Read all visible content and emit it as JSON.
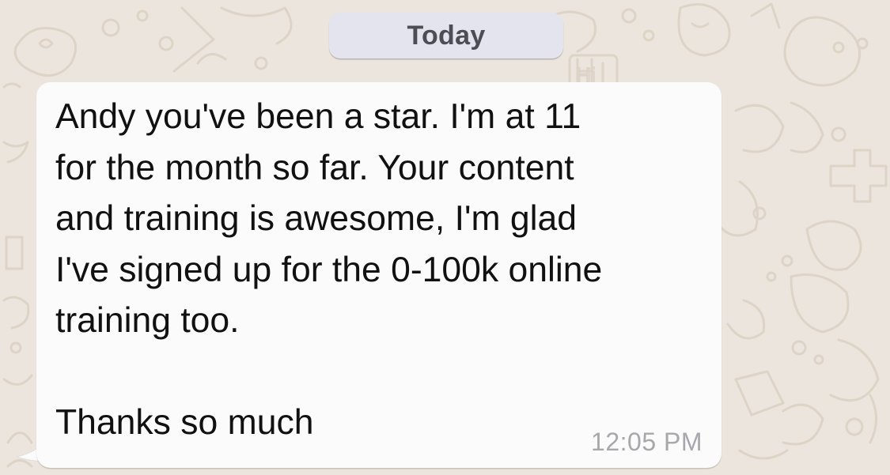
{
  "chat": {
    "date_separator": "Today",
    "messages": [
      {
        "direction": "incoming",
        "text": "Andy you've been a star. I'm at 11\nfor the month so far. Your content\nand training is awesome, I'm glad\nI've signed up for the 0-100k online\ntraining too.\n\nThanks so much",
        "time": "12:05 PM"
      }
    ]
  },
  "wallpaper": {
    "doodle_text": "Hi"
  },
  "colors": {
    "wallpaper": "#ece5dd",
    "doodle_stroke": "#ddd3c7",
    "date_pill": "#e3e4ee",
    "bubble": "#fbfbfb",
    "message_text": "#111111",
    "timestamp": "#a8a8ac"
  }
}
